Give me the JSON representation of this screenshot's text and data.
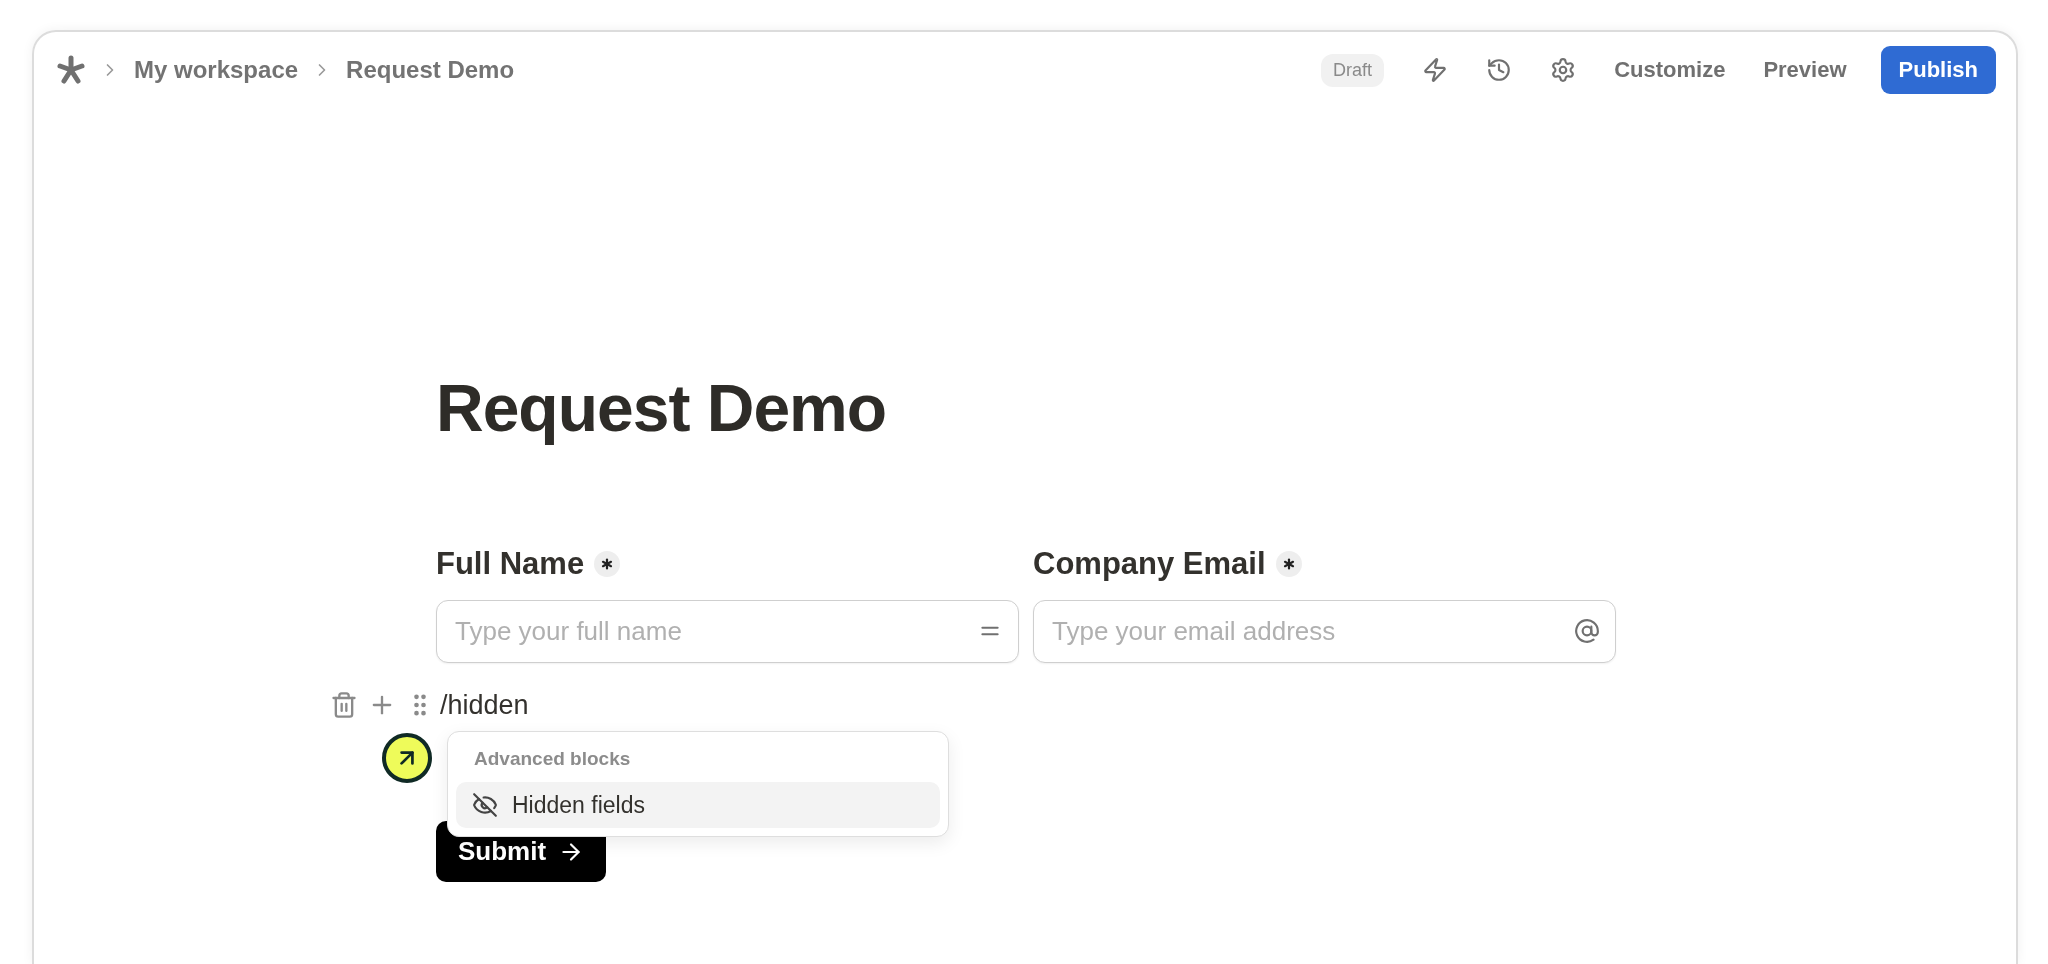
{
  "breadcrumbs": [
    "My workspace",
    "Request Demo"
  ],
  "status_badge": "Draft",
  "toolbar_buttons": [
    "Customize",
    "Preview"
  ],
  "publish_button": "Publish",
  "form": {
    "title": "Request Demo",
    "fields": [
      {
        "label": "Full Name",
        "required": true,
        "placeholder": "Type your full name",
        "kind": "text"
      },
      {
        "label": "Company Email",
        "required": true,
        "placeholder": "Type your email address",
        "kind": "email"
      }
    ],
    "command_text": "/hidden",
    "submit_button": "Submit"
  },
  "command_menu": {
    "section": "Advanced blocks",
    "items": [
      {
        "label": "Hidden fields",
        "selected": true
      }
    ]
  }
}
